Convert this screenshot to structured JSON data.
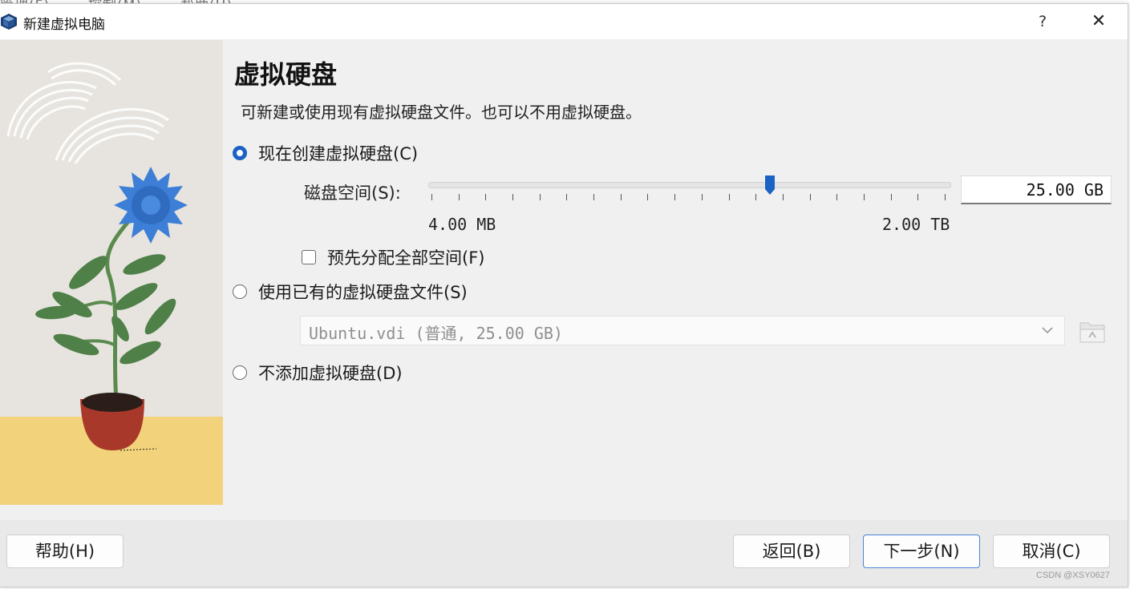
{
  "window": {
    "title": "新建虚拟电脑",
    "help_glyph": "?",
    "close_glyph": "✕"
  },
  "page": {
    "title": "虚拟硬盘",
    "subtitle": "可新建或使用现有虚拟硬盘文件。也可以不用虚拟硬盘。"
  },
  "options": {
    "create": {
      "label": "现在创建虚拟硬盘(C)",
      "selected": true
    },
    "existing": {
      "label": "使用已有的虚拟硬盘文件(S)",
      "selected": false
    },
    "none": {
      "label": "不添加虚拟硬盘(D)",
      "selected": false
    }
  },
  "disk_size": {
    "label": "磁盘空间(S):",
    "value": "25.00 GB",
    "min_label": "4.00 MB",
    "max_label": "2.00 TB",
    "slider_fraction": 0.655
  },
  "preallocate": {
    "label": "预先分配全部空间(F)",
    "checked": false
  },
  "existing_file": {
    "selected": "Ubuntu.vdi (普通, 25.00 GB)"
  },
  "buttons": {
    "help": "帮助(H)",
    "back": "返回(B)",
    "next": "下一步(N)",
    "cancel": "取消(C)"
  },
  "colors": {
    "accent": "#1a62c4",
    "default_button_border": "#4a84d6"
  },
  "watermark": "CSDN @XSY0627"
}
